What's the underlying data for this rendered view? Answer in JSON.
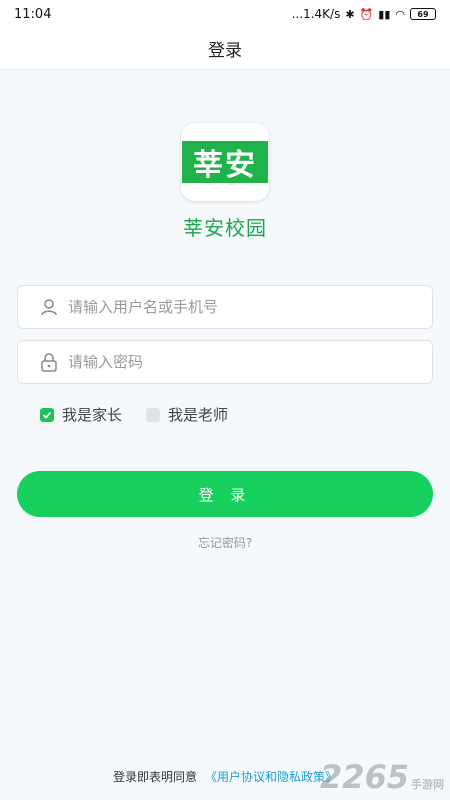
{
  "status_bar": {
    "time": "11:04",
    "network_speed": "...1.4K/s",
    "battery": "69",
    "icons": [
      "bluetooth-icon",
      "alarm-icon",
      "hd-signal-icon",
      "wifi-icon",
      "battery-icon"
    ]
  },
  "header": {
    "title": "登录"
  },
  "brand": {
    "logo_text": "莘安",
    "app_name": "莘安校园",
    "color": "#1fb34a"
  },
  "form": {
    "username_placeholder": "请输入用户名或手机号",
    "password_placeholder": "请输入密码",
    "roles": [
      {
        "label": "我是家长",
        "checked": true
      },
      {
        "label": "我是老师",
        "checked": false
      }
    ],
    "login_label": "登 录",
    "forgot_label": "忘记密码?"
  },
  "footer": {
    "agree_text": "登录即表明同意",
    "policy_link": "《用户协议和隐私政策》"
  },
  "watermark": {
    "number": "2265",
    "suffix": "手游网"
  },
  "colors": {
    "accent": "#16cf5c",
    "link": "#1a9fd0",
    "background": "#f5f9fc"
  }
}
